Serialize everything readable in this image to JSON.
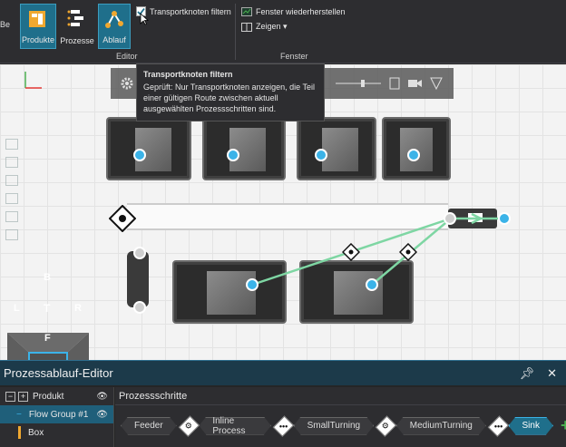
{
  "ribbon": {
    "left_stub": "Be",
    "buttons": {
      "produkte": "Produkte",
      "prozesse": "Prozesse",
      "ablauf": "Ablauf"
    },
    "checkbox_label": "Transportknoten filtern",
    "group_editor": "Editor",
    "fenster_restore": "Fenster wiederherstellen",
    "zeigen": "Zeigen ▾",
    "group_fenster": "Fenster"
  },
  "tooltip": {
    "title": "Transportknoten filtern",
    "body": "Geprüft: Nur Transportknoten anzeigen, die Teil einer gültigen Route zwischen aktuell ausgewählten Prozessschritten sind."
  },
  "compass": {
    "top": "B",
    "left": "L",
    "center": "T",
    "right": "R",
    "bottom": "F"
  },
  "panel": {
    "title": "Prozessablauf-Editor",
    "tree_header": "Produkt",
    "tree_items": [
      "Flow Group #1",
      "Box"
    ],
    "steps_header": "Prozessschritte",
    "steps": [
      "Feeder",
      "Inline Process",
      "SmallTurning",
      "MediumTurning",
      "Sink"
    ]
  },
  "colors": {
    "accent": "#1f6f8b",
    "node_blue": "#3bb3e8",
    "route_green": "#7ed6a3"
  }
}
